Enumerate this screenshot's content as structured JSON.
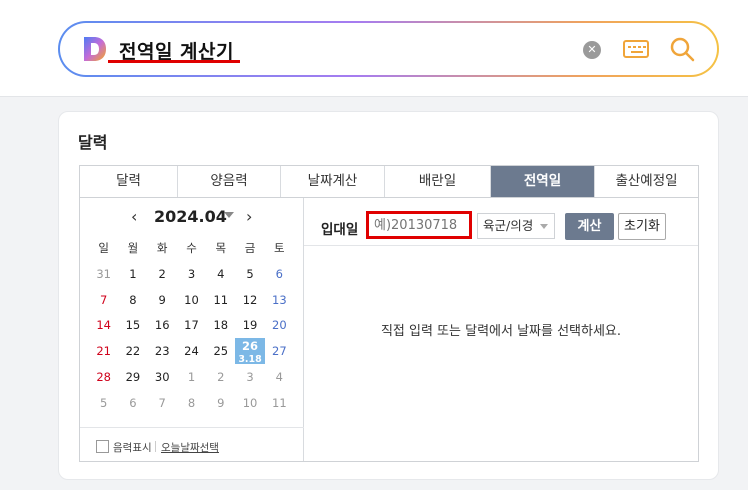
{
  "search": {
    "query": "전역일 계산기",
    "clear_icon": "✕"
  },
  "card": {
    "title": "달력"
  },
  "tabs": [
    "달력",
    "양음력",
    "날짜계산",
    "배란일",
    "전역일",
    "출산예정일"
  ],
  "active_tab": "전역일",
  "calendar": {
    "prev": "‹",
    "next": "›",
    "month_label": "2024.04",
    "weekdays": [
      "일",
      "월",
      "화",
      "수",
      "목",
      "금",
      "토"
    ],
    "weeks": [
      [
        "31",
        "1",
        "2",
        "3",
        "4",
        "5",
        "6"
      ],
      [
        "7",
        "8",
        "9",
        "10",
        "11",
        "12",
        "13"
      ],
      [
        "14",
        "15",
        "16",
        "17",
        "18",
        "19",
        "20"
      ],
      [
        "21",
        "22",
        "23",
        "24",
        "25",
        "26",
        "27"
      ],
      [
        "28",
        "29",
        "30",
        "1",
        "2",
        "3",
        "4"
      ],
      [
        "5",
        "6",
        "7",
        "8",
        "9",
        "10",
        "11"
      ]
    ],
    "today": {
      "day": "26",
      "lunar": "3.18"
    },
    "lunar_toggle_label": "음력표시",
    "select_today_label": "오늘날짜선택"
  },
  "form": {
    "label": "입대일",
    "date_placeholder": "예)20130718",
    "branch_value": "육군/의경",
    "calc_label": "계산",
    "reset_label": "초기화"
  },
  "message": "직접 입력 또는 달력에서 날짜를 선택하세요.",
  "colors": {
    "accent": "#6c7a8f",
    "highlight": "#e00000",
    "today": "#7cb8e6"
  }
}
